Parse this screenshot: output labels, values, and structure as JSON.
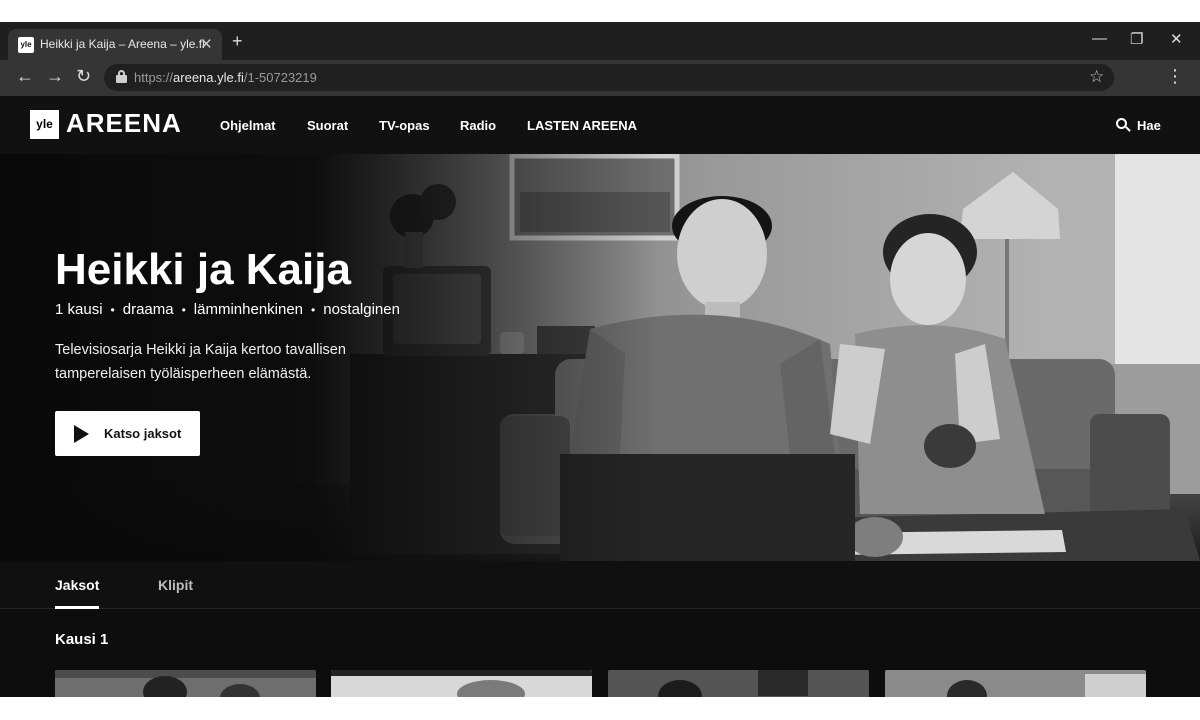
{
  "browser": {
    "tab_title": "Heikki ja Kaija – Areena – yle.fi",
    "favicon_text": "yle",
    "close_glyph": "✕",
    "newtab_glyph": "+",
    "url_prefix": "https://",
    "url_host": "areena.yle.fi",
    "url_path": "/1-50723219",
    "icons": {
      "back": "←",
      "forward": "→",
      "reload": "↻",
      "star": "☆",
      "menu": "⋮",
      "minimize": "—",
      "restore": "❐",
      "close": "✕"
    }
  },
  "header": {
    "logo_box": "yle",
    "logo_word": "AREENA",
    "nav": [
      "Ohjelmat",
      "Suorat",
      "TV-opas",
      "Radio",
      "LASTEN AREENA"
    ],
    "search_label": "Hae"
  },
  "hero": {
    "title": "Heikki ja Kaija",
    "meta": [
      "1 kausi",
      "draama",
      "lämminhenkinen",
      "nostalginen"
    ],
    "meta_separator": "•",
    "description": "Televisiosarja Heikki ja Kaija kertoo tavallisen tamperelaisen työläisperheen elämästä.",
    "watch_button": "Katso jaksot"
  },
  "content_tabs": [
    "Jaksot",
    "Klipit"
  ],
  "season": {
    "title": "Kausi 1",
    "episode_cards": 4
  }
}
